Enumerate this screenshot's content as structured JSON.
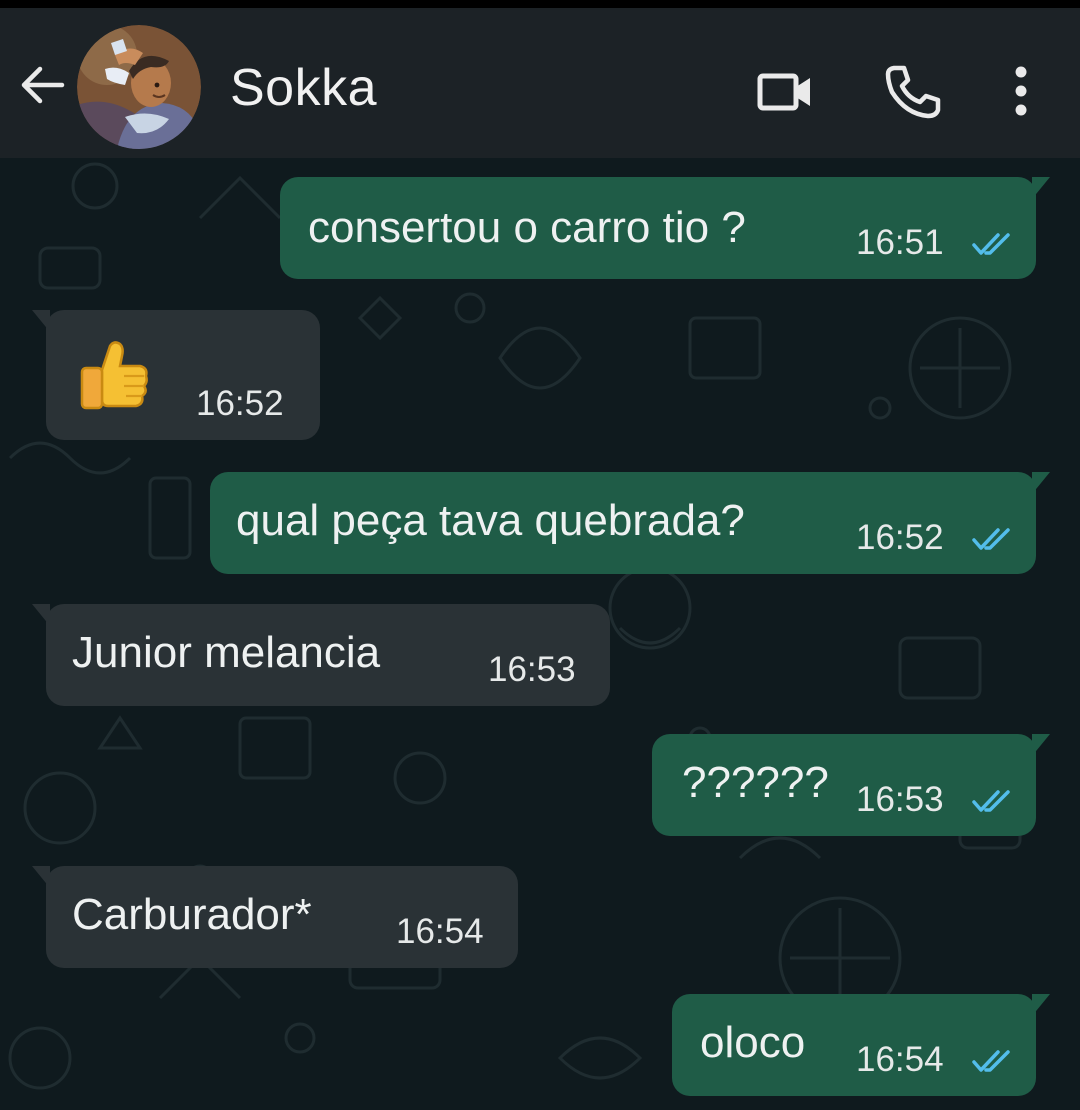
{
  "header": {
    "contact_name": "Sokka",
    "back_icon": "arrow-left-icon",
    "video_icon": "video-camera-icon",
    "call_icon": "phone-icon",
    "menu_icon": "more-vertical-icon"
  },
  "messages": [
    {
      "direction": "outgoing",
      "text": "consertou o carro tio ?",
      "time": "16:51",
      "status": "read"
    },
    {
      "direction": "incoming",
      "text": "👍",
      "emoji": "thumbs-up-icon",
      "time": "16:52"
    },
    {
      "direction": "outgoing",
      "text": "qual peça tava quebrada?",
      "time": "16:52",
      "status": "read"
    },
    {
      "direction": "incoming",
      "text": "Junior melancia",
      "time": "16:53"
    },
    {
      "direction": "outgoing",
      "text": "??????",
      "time": "16:53",
      "status": "read"
    },
    {
      "direction": "incoming",
      "text": "Carburador*",
      "time": "16:54"
    },
    {
      "direction": "outgoing",
      "text": "oloco",
      "time": "16:54",
      "status": "read"
    }
  ],
  "colors": {
    "header_bg": "#1c2226",
    "chat_bg": "#0f1a1e",
    "outgoing_bubble": "#1f5c47",
    "incoming_bubble": "#2a3236",
    "read_ticks": "#53bdeb"
  }
}
